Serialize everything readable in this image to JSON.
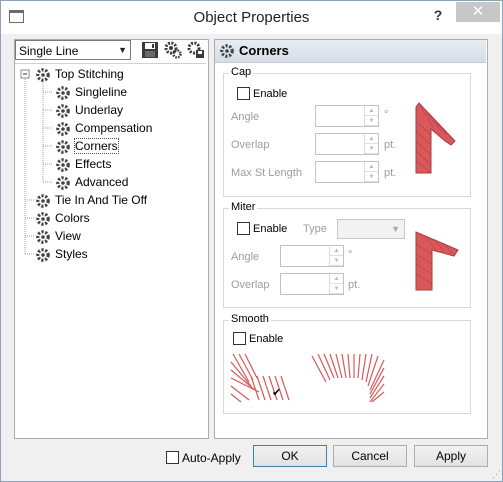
{
  "window": {
    "title": "Object Properties",
    "help": "?",
    "close": "✕"
  },
  "left": {
    "style_select": "Single Line",
    "toolbar_icons": [
      "save-icon",
      "gears-icon",
      "settings-save-icon"
    ],
    "tree": [
      {
        "label": "Top Stitching",
        "level": 0,
        "expanded": true
      },
      {
        "label": "Singleline",
        "level": 1
      },
      {
        "label": "Underlay",
        "level": 1
      },
      {
        "label": "Compensation",
        "level": 1
      },
      {
        "label": "Corners",
        "level": 1,
        "selected": true
      },
      {
        "label": "Effects",
        "level": 1
      },
      {
        "label": "Advanced",
        "level": 1
      },
      {
        "label": "Tie In And Tie Off",
        "level": 0
      },
      {
        "label": "Colors",
        "level": 0
      },
      {
        "label": "View",
        "level": 0
      },
      {
        "label": "Styles",
        "level": 0
      }
    ]
  },
  "right": {
    "header": "Corners",
    "cap": {
      "title": "Cap",
      "enable": "Enable",
      "angle_label": "Angle",
      "angle_unit": "°",
      "overlap_label": "Overlap",
      "overlap_unit": "pt.",
      "max_label": "Max St Length",
      "max_unit": "pt."
    },
    "miter": {
      "title": "Miter",
      "enable": "Enable",
      "type_label": "Type",
      "angle_label": "Angle",
      "angle_unit": "°",
      "overlap_label": "Overlap",
      "overlap_unit": "pt."
    },
    "smooth": {
      "title": "Smooth",
      "enable": "Enable",
      "checkmark": "✔"
    }
  },
  "footer": {
    "auto_apply": "Auto-Apply",
    "ok": "OK",
    "cancel": "Cancel",
    "apply": "Apply"
  },
  "colors": {
    "stitch": "#d9585a",
    "stitch_dark": "#a83b3d",
    "header_bg": "#dde4ee",
    "ok_border": "#3c7fb1"
  }
}
